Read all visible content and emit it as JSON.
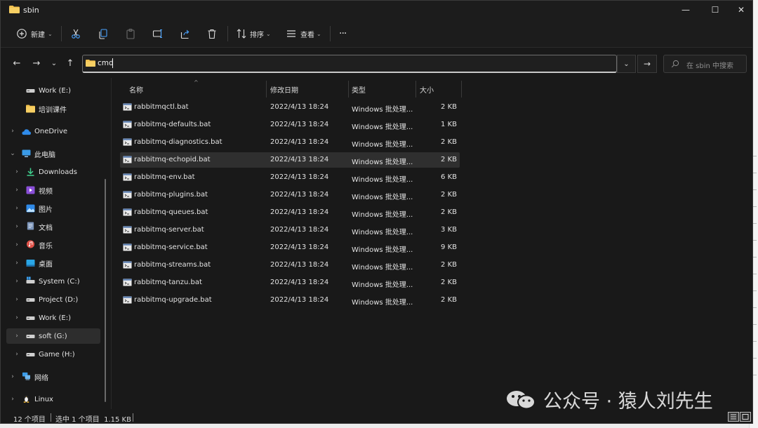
{
  "window": {
    "title": "sbin",
    "controls": {
      "minimize": "—",
      "maximize": "☐",
      "close": "✕"
    }
  },
  "toolbar": {
    "new_label": "新建",
    "sort_label": "排序",
    "view_label": "查看",
    "more": "···"
  },
  "address": {
    "value": "cmd"
  },
  "search": {
    "placeholder": "在 sbin 中搜索"
  },
  "sidebar": {
    "items": [
      {
        "label": "Work (E:)",
        "icon": "drive-icon",
        "chevron": ""
      },
      {
        "label": "培训课件",
        "icon": "folder-icon",
        "chevron": ""
      },
      {
        "label": "OneDrive",
        "icon": "cloud-icon",
        "chevron": "›"
      },
      {
        "label": "此电脑",
        "icon": "computer-icon",
        "chevron": "⌄"
      },
      {
        "label": "Downloads",
        "icon": "download-icon",
        "chevron": "›"
      },
      {
        "label": "视频",
        "icon": "video-icon",
        "chevron": "›"
      },
      {
        "label": "图片",
        "icon": "picture-icon",
        "chevron": "›"
      },
      {
        "label": "文档",
        "icon": "document-icon",
        "chevron": "›"
      },
      {
        "label": "音乐",
        "icon": "music-icon",
        "chevron": "›"
      },
      {
        "label": "桌面",
        "icon": "desktop-icon",
        "chevron": "›"
      },
      {
        "label": "System (C:)",
        "icon": "system-drive-icon",
        "chevron": "›"
      },
      {
        "label": "Project (D:)",
        "icon": "drive-icon",
        "chevron": "›"
      },
      {
        "label": "Work (E:)",
        "icon": "drive-icon",
        "chevron": "›"
      },
      {
        "label": "soft (G:)",
        "icon": "drive-icon",
        "chevron": "›"
      },
      {
        "label": "Game (H:)",
        "icon": "drive-icon",
        "chevron": "›"
      },
      {
        "label": "网络",
        "icon": "network-icon",
        "chevron": "›"
      },
      {
        "label": "Linux",
        "icon": "linux-icon",
        "chevron": "›"
      }
    ]
  },
  "table": {
    "headers": {
      "name": "名称",
      "date": "修改日期",
      "type": "类型",
      "size": "大小"
    },
    "rows": [
      {
        "name": "rabbitmqctl.bat",
        "date": "2022/4/13 18:24",
        "type": "Windows 批处理...",
        "size": "2 KB"
      },
      {
        "name": "rabbitmq-defaults.bat",
        "date": "2022/4/13 18:24",
        "type": "Windows 批处理...",
        "size": "1 KB"
      },
      {
        "name": "rabbitmq-diagnostics.bat",
        "date": "2022/4/13 18:24",
        "type": "Windows 批处理...",
        "size": "2 KB"
      },
      {
        "name": "rabbitmq-echopid.bat",
        "date": "2022/4/13 18:24",
        "type": "Windows 批处理...",
        "size": "2 KB"
      },
      {
        "name": "rabbitmq-env.bat",
        "date": "2022/4/13 18:24",
        "type": "Windows 批处理...",
        "size": "6 KB"
      },
      {
        "name": "rabbitmq-plugins.bat",
        "date": "2022/4/13 18:24",
        "type": "Windows 批处理...",
        "size": "2 KB"
      },
      {
        "name": "rabbitmq-queues.bat",
        "date": "2022/4/13 18:24",
        "type": "Windows 批处理...",
        "size": "2 KB"
      },
      {
        "name": "rabbitmq-server.bat",
        "date": "2022/4/13 18:24",
        "type": "Windows 批处理...",
        "size": "3 KB"
      },
      {
        "name": "rabbitmq-service.bat",
        "date": "2022/4/13 18:24",
        "type": "Windows 批处理...",
        "size": "9 KB"
      },
      {
        "name": "rabbitmq-streams.bat",
        "date": "2022/4/13 18:24",
        "type": "Windows 批处理...",
        "size": "2 KB"
      },
      {
        "name": "rabbitmq-tanzu.bat",
        "date": "2022/4/13 18:24",
        "type": "Windows 批处理...",
        "size": "2 KB"
      },
      {
        "name": "rabbitmq-upgrade.bat",
        "date": "2022/4/13 18:24",
        "type": "Windows 批处理...",
        "size": "2 KB"
      }
    ]
  },
  "status": {
    "count": "12 个项目",
    "selection": "选中 1 个项目  1.15 KB"
  },
  "watermark": {
    "text": "公众号 · 猿人刘先生"
  },
  "colors": {
    "window_bg": "#191919",
    "folder_yellow": "#f2c14e",
    "selected_row": "#2f2f2f",
    "accent_blue": "#4aa3ff"
  }
}
